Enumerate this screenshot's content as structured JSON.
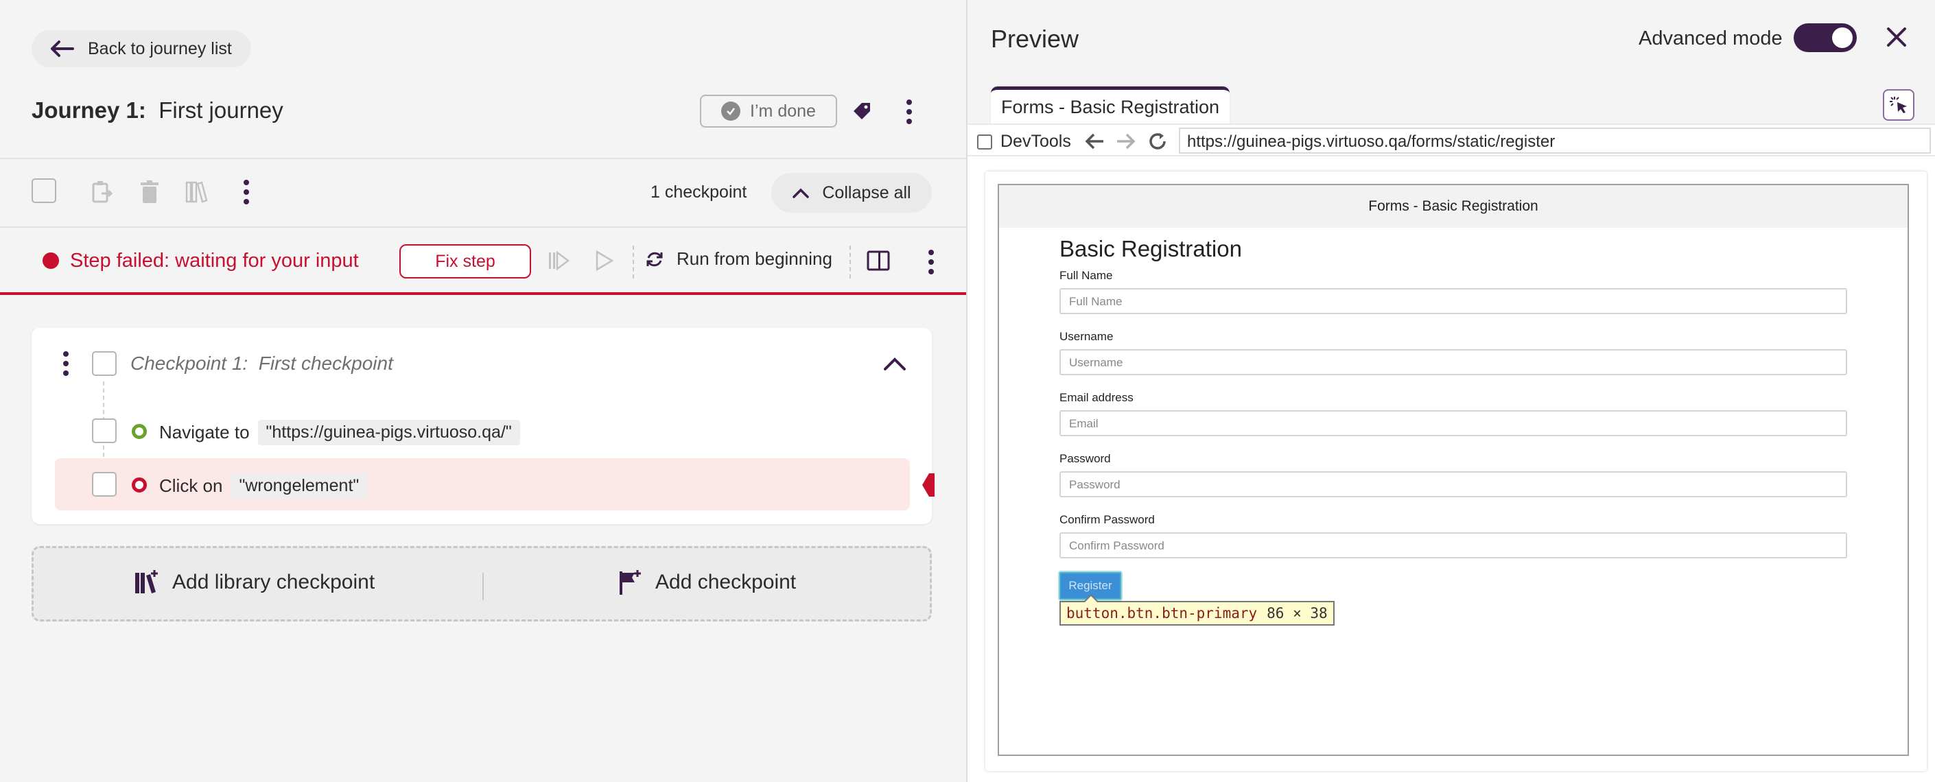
{
  "left": {
    "back_label": "Back to journey list",
    "journey_prefix": "Journey 1:",
    "journey_name": "First journey",
    "done_label": "I’m done",
    "checkpoint_count": "1 checkpoint",
    "collapse_label": "Collapse all",
    "status": {
      "text": "Step failed: waiting for your input",
      "fix_label": "Fix step",
      "run_label": "Run from beginning",
      "color": "#c8102e"
    },
    "checkpoint": {
      "prefix": "Checkpoint 1:",
      "name": "First checkpoint",
      "steps": [
        {
          "action": "Navigate to",
          "target": "\"https://guinea-pigs.virtuoso.qa/\"",
          "status": "passed",
          "color": "#6ba22b"
        },
        {
          "action": "Click on",
          "target": "\"wrongelement\"",
          "status": "failed",
          "color": "#c8102e"
        }
      ]
    },
    "add_library_label": "Add library checkpoint",
    "add_checkpoint_label": "Add checkpoint"
  },
  "right": {
    "title": "Preview",
    "advanced_label": "Advanced mode",
    "advanced_on": true,
    "tab_label": "Forms - Basic Registration",
    "devtools_label": "DevTools",
    "url": "https://guinea-pigs.virtuoso.qa/forms/static/register",
    "page": {
      "header": "Forms - Basic Registration",
      "heading": "Basic Registration",
      "fields": [
        {
          "label": "Full Name",
          "placeholder": "Full Name"
        },
        {
          "label": "Username",
          "placeholder": "Username"
        },
        {
          "label": "Email address",
          "placeholder": "Email"
        },
        {
          "label": "Password",
          "placeholder": "Password"
        },
        {
          "label": "Confirm Password",
          "placeholder": "Confirm Password"
        }
      ],
      "register_label": "Register",
      "tooltip_selector": "button.btn.btn-primary",
      "tooltip_size": "86 × 38"
    }
  },
  "colors": {
    "brand": "#3b1e4a",
    "error": "#c8102e",
    "success": "#6ba22b"
  }
}
